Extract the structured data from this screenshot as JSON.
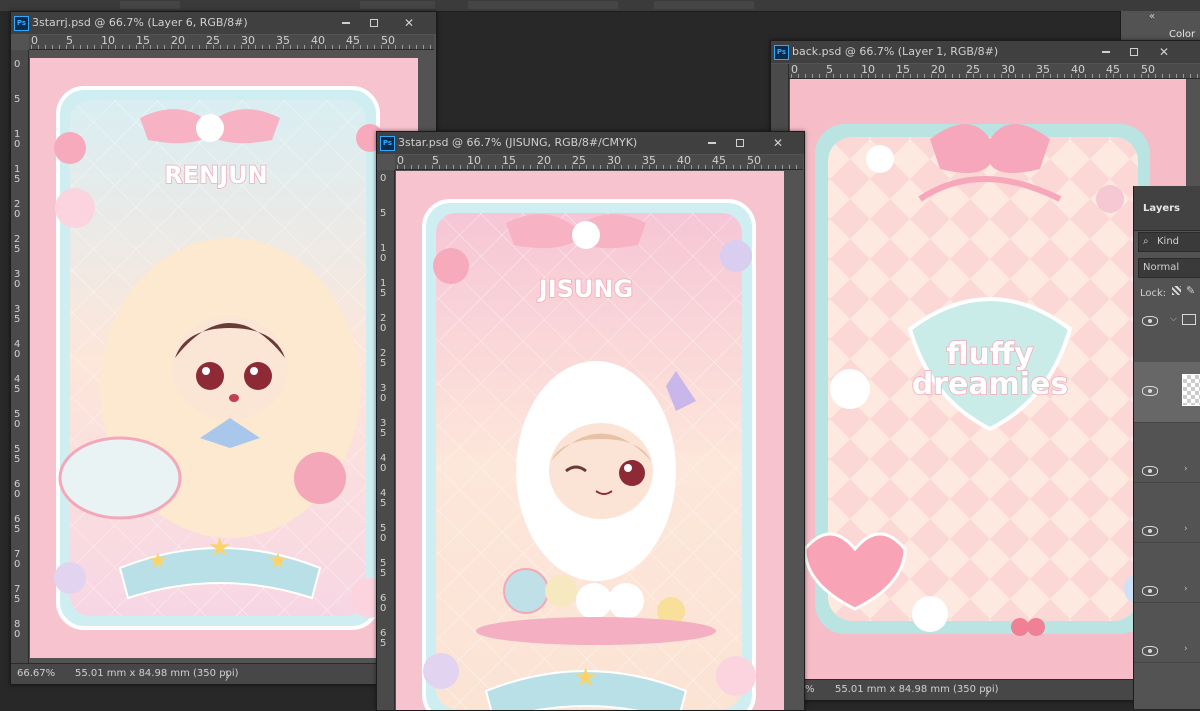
{
  "windows": {
    "renjun": {
      "title": "3starrj.psd @ 66.7% (Layer 6, RGB/8#)",
      "ruler_marks": [
        "0",
        "5",
        "10",
        "15",
        "20",
        "25",
        "30",
        "35",
        "40",
        "45",
        "50"
      ],
      "vruler_marks": [
        "0",
        "5",
        "1 0",
        "1 5",
        "2 0",
        "2 5",
        "3 0",
        "3 5",
        "4 0",
        "4 5",
        "5 0",
        "5 5",
        "6 0",
        "6 5",
        "7 0",
        "7 5",
        "8 0"
      ],
      "zoom": "66.67%",
      "doc_size": "55.01 mm x 84.98 mm (350 ppi)",
      "status_arrow": "〉",
      "card_name": "RENJUN"
    },
    "jisung": {
      "title": "3star.psd @ 66.7% (JISUNG, RGB/8#/CMYK)",
      "ruler_marks": [
        "0",
        "5",
        "10",
        "15",
        "20",
        "25",
        "30",
        "35",
        "40",
        "45",
        "50"
      ],
      "vruler_marks": [
        "0",
        "5",
        "1 0",
        "1 5",
        "2 0",
        "2 5",
        "3 0",
        "3 5",
        "4 0",
        "4 5",
        "5 0",
        "5 5",
        "6 0",
        "6 5"
      ],
      "card_name": "JISUNG"
    },
    "back": {
      "title": "back.psd @ 66.7% (Layer 1, RGB/8#)",
      "ruler_marks": [
        "0",
        "5",
        "10",
        "15",
        "20",
        "25",
        "30",
        "35",
        "40",
        "45",
        "50"
      ],
      "zoom": "%",
      "doc_size": "55.01 mm x 84.98 mm (350 ppi)",
      "status_arrow": "〉",
      "logo_line1": "fluffy",
      "logo_line2": "dreamies"
    }
  },
  "color_panel": {
    "tab_label": "Color",
    "collapse_icon": "«"
  },
  "layers_panel": {
    "tab_label": "Layers",
    "kind_label": "Kind",
    "blend_mode": "Normal",
    "lock_label": "Lock:"
  },
  "colors": {
    "accent_ps": "#31a8ff",
    "canvas_pink": "#f8c4cf",
    "panel_bg": "#535353"
  }
}
